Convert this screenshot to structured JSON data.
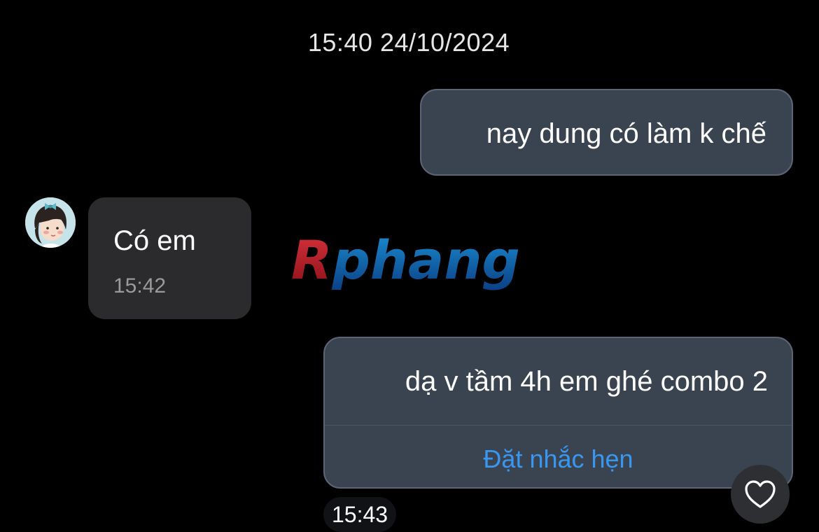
{
  "conversation": {
    "date_header": "15:40 24/10/2024",
    "messages": [
      {
        "direction": "outgoing",
        "text": "nay dung có làm k chế"
      },
      {
        "direction": "incoming",
        "text": "Có em",
        "time": "15:42"
      },
      {
        "direction": "outgoing",
        "text": "dạ v tầm 4h em ghé combo 2",
        "action": "Đặt nhắc hẹn",
        "time": "15:43"
      }
    ]
  },
  "watermark": {
    "text": "Rphang"
  },
  "icons": {
    "avatar": "girl-avatar",
    "reaction": "heart-outline-icon"
  },
  "colors": {
    "background": "#000000",
    "outgoing_bubble": "#3a4350",
    "incoming_bubble": "#2b2b2d",
    "link": "#3a97f0"
  }
}
